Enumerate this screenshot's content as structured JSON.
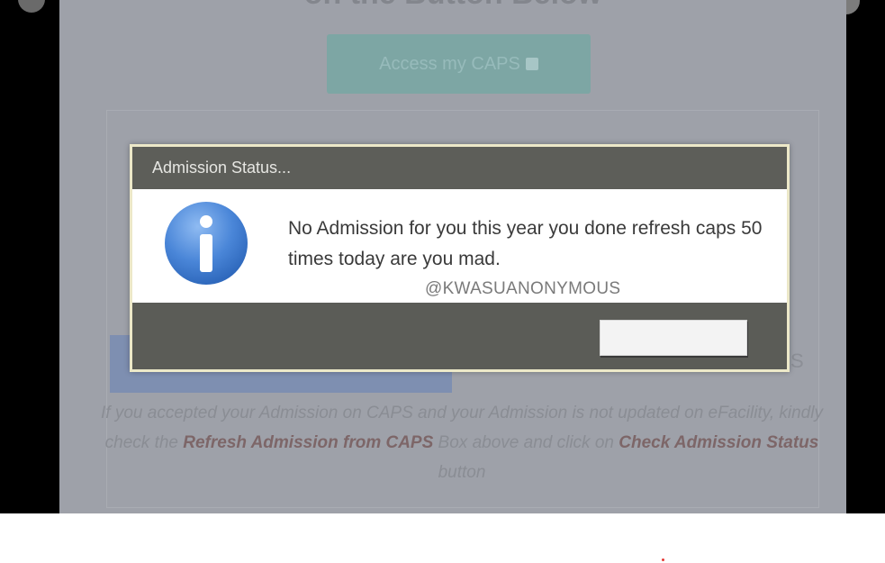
{
  "background_page": {
    "heading": "on the Button Below",
    "access_button_label": "Access my CAPS",
    "side_letter": "S",
    "note": {
      "part1": "If you accepted your Admission on CAPS and your Admission is not updated on eFacility, kindly check the ",
      "bold1": "Refresh Admission from CAPS",
      "part2": " Box above and click on ",
      "bold2": "Check Admission Status",
      "part3": " button"
    }
  },
  "dialog": {
    "title": "Admission Status...",
    "message": "No Admission for you this year you done refresh caps 50 times today are you mad.",
    "icon": "info-icon",
    "ok_button_label": ""
  },
  "watermark": "@KWASUANONYMOUS",
  "colors": {
    "dialog_header": "#5d5e59",
    "dialog_border": "#ece8c8",
    "info_icon_blue": "#4a86d8",
    "overlay": "#9ea1a9"
  }
}
